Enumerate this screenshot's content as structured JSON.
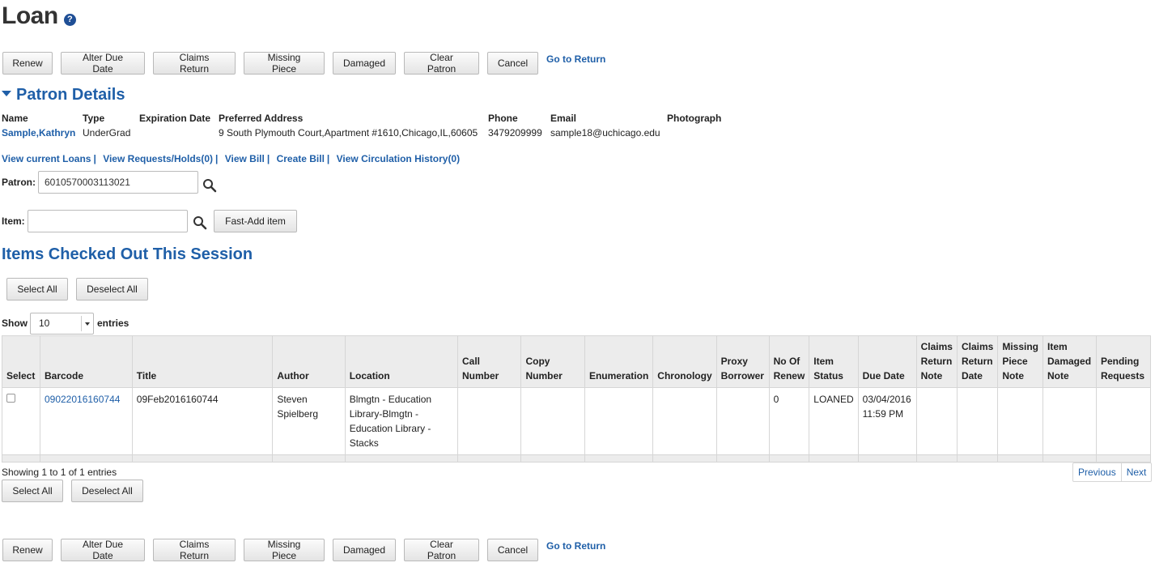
{
  "page": {
    "title": "Loan",
    "help_icon": "?"
  },
  "actions": {
    "renew": "Renew",
    "alter_due_date": "Alter Due Date",
    "claims_return": "Claims Return",
    "missing_piece": "Missing Piece",
    "damaged": "Damaged",
    "clear_patron": "Clear Patron",
    "cancel": "Cancel",
    "go_to_return": "Go to Return"
  },
  "patron_details": {
    "heading": "Patron Details",
    "columns": {
      "name": "Name",
      "type": "Type",
      "expiration_date": "Expiration Date",
      "preferred_address": "Preferred Address",
      "phone": "Phone",
      "email": "Email",
      "photograph": "Photograph"
    },
    "values": {
      "name": "Sample,Kathryn",
      "type": "UnderGrad",
      "expiration_date": "",
      "preferred_address": "9 South Plymouth Court,Apartment #1610,Chicago,IL,60605",
      "phone": "3479209999",
      "email": "sample18@uchicago.edu",
      "photograph": ""
    },
    "links": {
      "view_current_loans": "View current Loans",
      "view_requests_holds": "View Requests/Holds(0)",
      "view_bill": "View Bill",
      "create_bill": "Create Bill",
      "view_circulation_history": "View Circulation History(0)",
      "separator": "|"
    }
  },
  "patron_field": {
    "label": "Patron:",
    "value": "6010570003113021"
  },
  "item_field": {
    "label": "Item:",
    "value": "",
    "fast_add": "Fast-Add item"
  },
  "session": {
    "heading": "Items Checked Out This Session",
    "select_all": "Select All",
    "deselect_all": "Deselect All",
    "show_label": "Show",
    "page_size": "10",
    "entries_label": "entries",
    "columns": {
      "select": "Select",
      "barcode": "Barcode",
      "title": "Title",
      "author": "Author",
      "location": "Location",
      "call_number": "Call Number",
      "copy_number": "Copy Number",
      "enumeration": "Enumeration",
      "chronology": "Chronology",
      "proxy_borrower": "Proxy Borrower",
      "no_of_renew": "No Of Renew",
      "item_status": "Item Status",
      "due_date": "Due Date",
      "claims_return_note": "Claims Return Note",
      "claims_return_date": "Claims Return Date",
      "missing_piece_note": "Missing Piece Note",
      "item_damaged_note": "Item Damaged Note",
      "pending_requests": "Pending Requests"
    },
    "rows": [
      {
        "barcode": "09022016160744",
        "title": "09Feb2016160744",
        "author": "Steven Spielberg",
        "location": "Blmgtn - Education Library-Blmgtn - Education Library - Stacks",
        "call_number": "",
        "copy_number": "",
        "enumeration": "",
        "chronology": "",
        "proxy_borrower": "",
        "no_of_renew": "0",
        "item_status": "LOANED",
        "due_date": "03/04/2016 11:59 PM",
        "claims_return_note": "",
        "claims_return_date": "",
        "missing_piece_note": "",
        "item_damaged_note": "",
        "pending_requests": ""
      }
    ],
    "showing": "Showing 1 to 1 of 1 entries",
    "previous": "Previous",
    "next": "Next"
  },
  "colors": {
    "link": "#1f5fa8",
    "header_bg": "#ececec",
    "help_icon_bg": "#1f4f96"
  }
}
